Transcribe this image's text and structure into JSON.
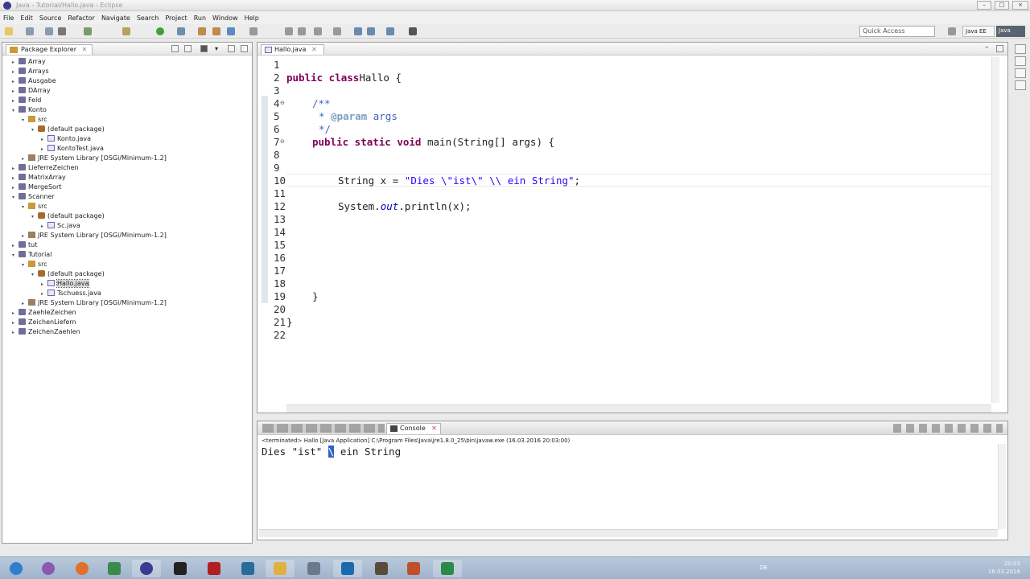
{
  "window": {
    "title": "Java - Tutorial/Hallo.java - Eclipse"
  },
  "menu": [
    "File",
    "Edit",
    "Source",
    "Refactor",
    "Navigate",
    "Search",
    "Project",
    "Run",
    "Window",
    "Help"
  ],
  "toolbar": {
    "quick_access_placeholder": "Quick Access",
    "perspective_java_ee": "Java EE",
    "perspective_java": "Java"
  },
  "package_explorer": {
    "title": "Package Explorer",
    "items": [
      {
        "label": "Array",
        "indent": 0,
        "icon": "project-icon",
        "twisty": "▸"
      },
      {
        "label": "Arrays",
        "indent": 0,
        "icon": "project-icon",
        "twisty": "▸"
      },
      {
        "label": "Ausgabe",
        "indent": 0,
        "icon": "project-icon",
        "twisty": "▸"
      },
      {
        "label": "DArray",
        "indent": 0,
        "icon": "project-icon",
        "twisty": "▸"
      },
      {
        "label": "Feld",
        "indent": 0,
        "icon": "project-icon",
        "twisty": "▸"
      },
      {
        "label": "Konto",
        "indent": 0,
        "icon": "project-icon",
        "twisty": "▾"
      },
      {
        "label": "src",
        "indent": 1,
        "icon": "source-folder-icon",
        "twisty": "▾"
      },
      {
        "label": "(default package)",
        "indent": 2,
        "icon": "package-icon",
        "twisty": "▾"
      },
      {
        "label": "Konto.java",
        "indent": 3,
        "icon": "java-file-icon",
        "twisty": "▸"
      },
      {
        "label": "KontoTest.java",
        "indent": 3,
        "icon": "java-file-icon",
        "twisty": "▸"
      },
      {
        "label": "JRE System Library [OSGi/Minimum-1.2]",
        "indent": 1,
        "icon": "library-icon",
        "twisty": "▸"
      },
      {
        "label": "LieferreZeichen",
        "indent": 0,
        "icon": "project-icon",
        "twisty": "▸"
      },
      {
        "label": "MatrixArray",
        "indent": 0,
        "icon": "project-icon",
        "twisty": "▸"
      },
      {
        "label": "MergeSort",
        "indent": 0,
        "icon": "project-icon",
        "twisty": "▸"
      },
      {
        "label": "Scanner",
        "indent": 0,
        "icon": "project-icon",
        "twisty": "▾"
      },
      {
        "label": "src",
        "indent": 1,
        "icon": "source-folder-icon",
        "twisty": "▾"
      },
      {
        "label": "(default package)",
        "indent": 2,
        "icon": "package-icon",
        "twisty": "▾"
      },
      {
        "label": "Sc.java",
        "indent": 3,
        "icon": "java-file-icon",
        "twisty": "▸"
      },
      {
        "label": "JRE System Library [OSGi/Minimum-1.2]",
        "indent": 1,
        "icon": "library-icon",
        "twisty": "▸"
      },
      {
        "label": "tut",
        "indent": 0,
        "icon": "project-icon",
        "twisty": "▸"
      },
      {
        "label": "Tutorial",
        "indent": 0,
        "icon": "project-icon",
        "twisty": "▾"
      },
      {
        "label": "src",
        "indent": 1,
        "icon": "source-folder-icon",
        "twisty": "▾"
      },
      {
        "label": "(default package)",
        "indent": 2,
        "icon": "package-icon",
        "twisty": "▾"
      },
      {
        "label": "Hallo.java",
        "indent": 3,
        "icon": "java-file-icon",
        "twisty": "▸",
        "selected": true
      },
      {
        "label": "Tschuess.java",
        "indent": 3,
        "icon": "java-file-icon",
        "twisty": "▸"
      },
      {
        "label": "JRE System Library [OSGi/Minimum-1.2]",
        "indent": 1,
        "icon": "library-icon",
        "twisty": "▸"
      },
      {
        "label": "ZaehleZeichen",
        "indent": 0,
        "icon": "project-icon",
        "twisty": "▸"
      },
      {
        "label": "ZeichenLiefern",
        "indent": 0,
        "icon": "project-icon",
        "twisty": "▸"
      },
      {
        "label": "ZeichenZaehlen",
        "indent": 0,
        "icon": "project-icon",
        "twisty": "▸"
      }
    ]
  },
  "editor": {
    "tab_label": "Hallo.java",
    "lines": [
      {
        "n": "1",
        "indent": 0,
        "tokens": []
      },
      {
        "n": "2",
        "indent": 0,
        "tokens": [
          [
            "kw",
            "public class"
          ],
          [
            "",
            "Hallo {"
          ]
        ]
      },
      {
        "n": "3",
        "indent": 0,
        "tokens": []
      },
      {
        "n": "4",
        "indent": 4,
        "fold": "⊖",
        "tokens": [
          [
            "cm",
            "/**"
          ]
        ]
      },
      {
        "n": "5",
        "indent": 5,
        "tokens": [
          [
            "cm",
            "* "
          ],
          [
            "tag",
            "@param"
          ],
          [
            "cm",
            " args"
          ]
        ]
      },
      {
        "n": "6",
        "indent": 5,
        "tokens": [
          [
            "cm",
            "*/"
          ]
        ]
      },
      {
        "n": "7",
        "indent": 4,
        "fold": "⊖",
        "tokens": [
          [
            "kw",
            "public static void"
          ],
          [
            "",
            " main(String[] args) {"
          ]
        ]
      },
      {
        "n": "8",
        "indent": 0,
        "tokens": []
      },
      {
        "n": "9",
        "indent": 0,
        "tokens": []
      },
      {
        "n": "10",
        "indent": 8,
        "tokens": [
          [
            "",
            "String x = "
          ],
          [
            "str",
            "\"Dies \\\"ist\\\" \\\\ ein String\""
          ],
          [
            "",
            ";"
          ]
        ]
      },
      {
        "n": "11",
        "indent": 0,
        "tokens": []
      },
      {
        "n": "12",
        "indent": 8,
        "tokens": [
          [
            "",
            "System."
          ],
          [
            "fld",
            "out"
          ],
          [
            "",
            ".println(x);"
          ]
        ]
      },
      {
        "n": "13",
        "indent": 0,
        "tokens": []
      },
      {
        "n": "14",
        "indent": 0,
        "tokens": []
      },
      {
        "n": "15",
        "indent": 0,
        "tokens": []
      },
      {
        "n": "16",
        "indent": 0,
        "tokens": []
      },
      {
        "n": "17",
        "indent": 0,
        "tokens": []
      },
      {
        "n": "18",
        "indent": 0,
        "tokens": []
      },
      {
        "n": "19",
        "indent": 4,
        "tokens": [
          [
            "",
            "}"
          ]
        ]
      },
      {
        "n": "20",
        "indent": 0,
        "tokens": []
      },
      {
        "n": "21",
        "indent": 0,
        "tokens": [
          [
            "",
            "}"
          ]
        ]
      },
      {
        "n": "22",
        "indent": 0,
        "tokens": []
      }
    ]
  },
  "console": {
    "tab_label": "Console",
    "status": "<terminated> Hallo [Java Application] C:\\Program Files\\Java\\jre1.8.0_25\\bin\\javaw.exe (16.03.2016 20:03:00)",
    "output_before": "Dies \"ist\" ",
    "output_highlight": "\\",
    "output_after": " ein String"
  },
  "taskbar": {
    "language": "DE",
    "time": "20:03",
    "date": "16.03.2016"
  }
}
